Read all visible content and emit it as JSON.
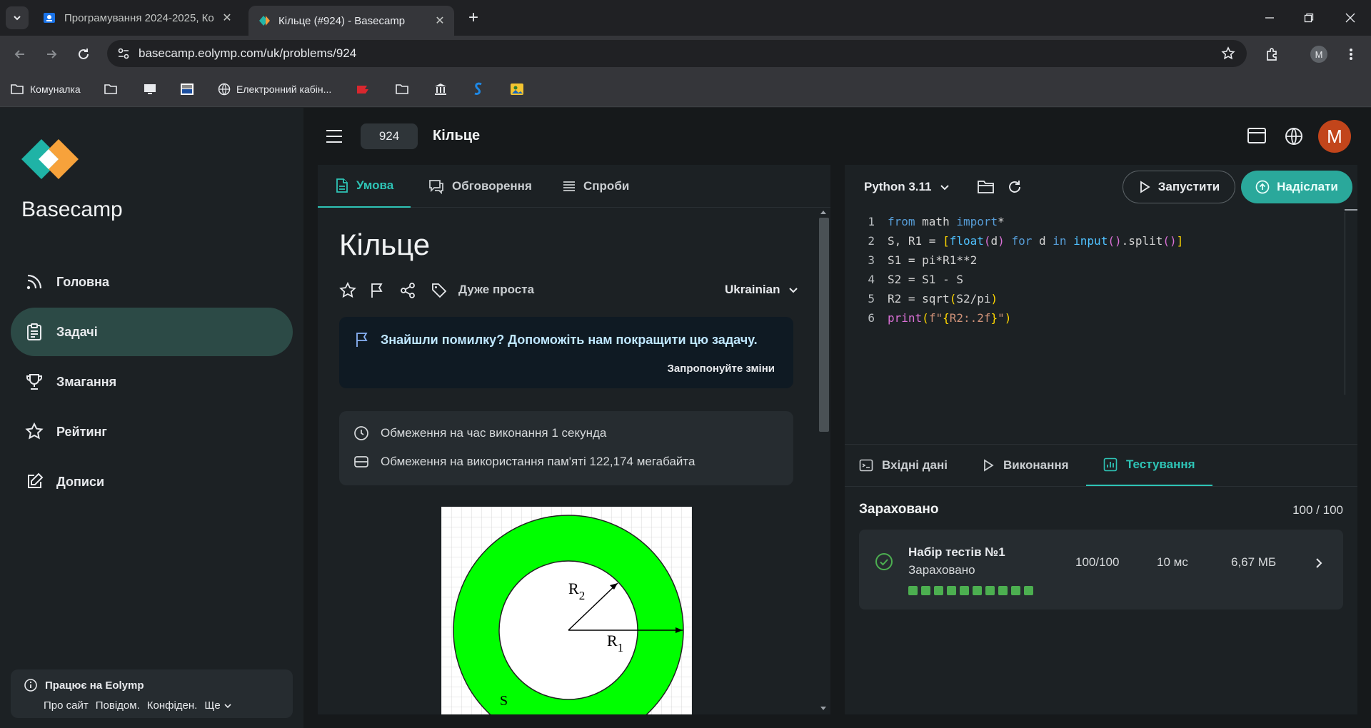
{
  "browser": {
    "tabs": [
      {
        "title": "Програмування 2024-2025, Ко",
        "active": false
      },
      {
        "title": "Кільце (#924) - Basecamp",
        "active": true
      }
    ],
    "url": "basecamp.eolymp.com/uk/problems/924",
    "profile_initial": "M",
    "bookmarks": [
      {
        "label": "Комуналка",
        "icon": "folder-icon"
      },
      {
        "label": "",
        "icon": "folder-icon"
      },
      {
        "label": "",
        "icon": "monitor-icon"
      },
      {
        "label": "",
        "icon": "auto100-icon"
      },
      {
        "label": "Електронний кабін...",
        "icon": "globe-icon"
      },
      {
        "label": "",
        "icon": "red-logo-icon"
      },
      {
        "label": "",
        "icon": "folder-icon"
      },
      {
        "label": "",
        "icon": "bank-icon"
      },
      {
        "label": "",
        "icon": "blue-s-icon"
      },
      {
        "label": "",
        "icon": "image-icon"
      }
    ]
  },
  "sidebar": {
    "brand": "Basecamp",
    "items": [
      {
        "label": "Головна",
        "icon": "rss-icon"
      },
      {
        "label": "Задачі",
        "icon": "clipboard-icon",
        "active": true
      },
      {
        "label": "Змагання",
        "icon": "trophy-icon"
      },
      {
        "label": "Рейтинг",
        "icon": "star-icon"
      },
      {
        "label": "Дописи",
        "icon": "edit-icon"
      }
    ],
    "powered_by": "Працює на Eolymp",
    "footer_links": [
      "Про сайт",
      "Повідом.",
      "Конфіден.",
      "Ще"
    ]
  },
  "header": {
    "problem_number": "924",
    "problem_title": "Кільце",
    "avatar_initial": "M"
  },
  "problem": {
    "tabs": [
      "Умова",
      "Обговорення",
      "Спроби"
    ],
    "title": "Кільце",
    "difficulty": "Дуже проста",
    "language": "Ukrainian",
    "notice": "Знайшли помилку? Допоможіть нам покращити цю задачу.",
    "notice_link": "Запропонуйте зміни",
    "time_limit": "Обмеження на час виконання 1 секунда",
    "memory_limit": "Обмеження на використання пам'яті 122,174 мегабайта",
    "figure_labels": {
      "r2": "R",
      "r2_sub": "2",
      "r1": "R",
      "r1_sub": "1",
      "s": "S"
    },
    "colors": {
      "ring": "#00ff00",
      "accent": "#2ec4b6"
    }
  },
  "editor": {
    "language": "Python 3.11",
    "run_label": "Запустити",
    "submit_label": "Надіслати",
    "code_lines": [
      "from math import*",
      "S, R1 = [float(d) for d in input().split()]",
      "S1 = pi*R1**2",
      "S2 = S1 - S",
      "R2 = sqrt(S2/pi)",
      "print(f\"{R2:.2f}\")"
    ]
  },
  "results": {
    "tabs": [
      "Вхідні дані",
      "Виконання",
      "Тестування"
    ],
    "verdict": "Зараховано",
    "score": "100 / 100",
    "test_set": {
      "name": "Набір тестів №1",
      "status": "Зараховано",
      "score": "100/100",
      "time": "10 мс",
      "memory": "6,67 МБ",
      "passed_tests": 10
    }
  }
}
